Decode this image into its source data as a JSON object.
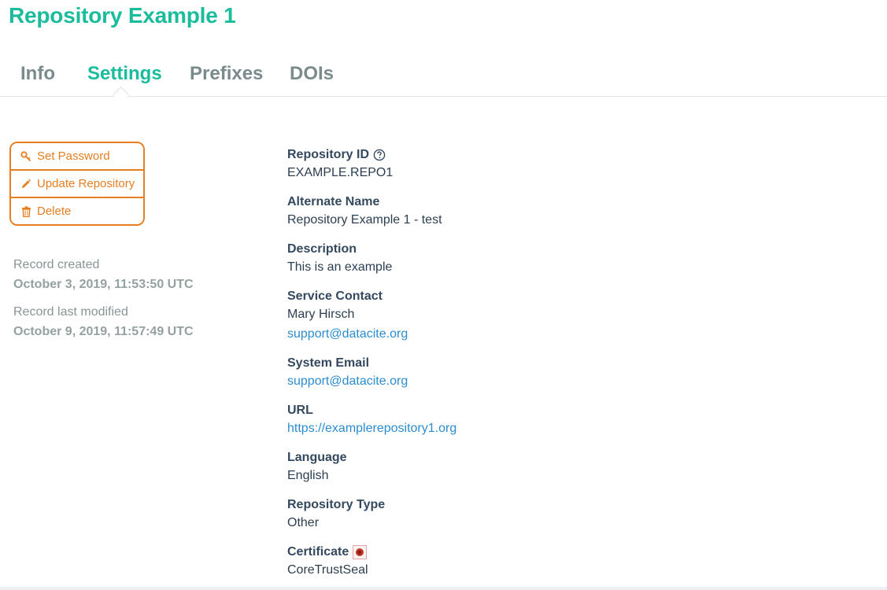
{
  "page": {
    "title": "Repository Example 1"
  },
  "tabs": [
    {
      "label": "Info"
    },
    {
      "label": "Settings",
      "active": true
    },
    {
      "label": "Prefixes"
    },
    {
      "label": "DOIs"
    }
  ],
  "actions": {
    "set_password": "Set Password",
    "update_repository": "Update Repository",
    "delete": "Delete"
  },
  "record": {
    "created_label": "Record created",
    "created_value": "October 3, 2019, 11:53:50 UTC",
    "modified_label": "Record last modified",
    "modified_value": "October 9, 2019, 11:57:49 UTC"
  },
  "details": {
    "repository_id": {
      "label": "Repository ID",
      "value": "EXAMPLE.REPO1"
    },
    "alternate_name": {
      "label": "Alternate Name",
      "value": "Repository Example 1 - test"
    },
    "description": {
      "label": "Description",
      "value": "This is an example"
    },
    "service_contact": {
      "label": "Service Contact",
      "name": "Mary Hirsch",
      "email": "support@datacite.org"
    },
    "system_email": {
      "label": "System Email",
      "value": "support@datacite.org"
    },
    "url": {
      "label": "URL",
      "value": "https://examplerepository1.org"
    },
    "language": {
      "label": "Language",
      "value": "English"
    },
    "repository_type": {
      "label": "Repository Type",
      "value": "Other"
    },
    "certificate": {
      "label": "Certificate",
      "value": "CoreTrustSeal"
    }
  },
  "colors": {
    "accent": "#1abc9c",
    "action": "#e67e22",
    "link": "#2d8ccd",
    "muted": "#8a9596"
  },
  "icons": {
    "help": "question-circle-icon",
    "certificate": "coretrustseal-badge-icon",
    "set_password": "key-icon",
    "update_repository": "pencil-icon",
    "delete": "trash-icon"
  }
}
